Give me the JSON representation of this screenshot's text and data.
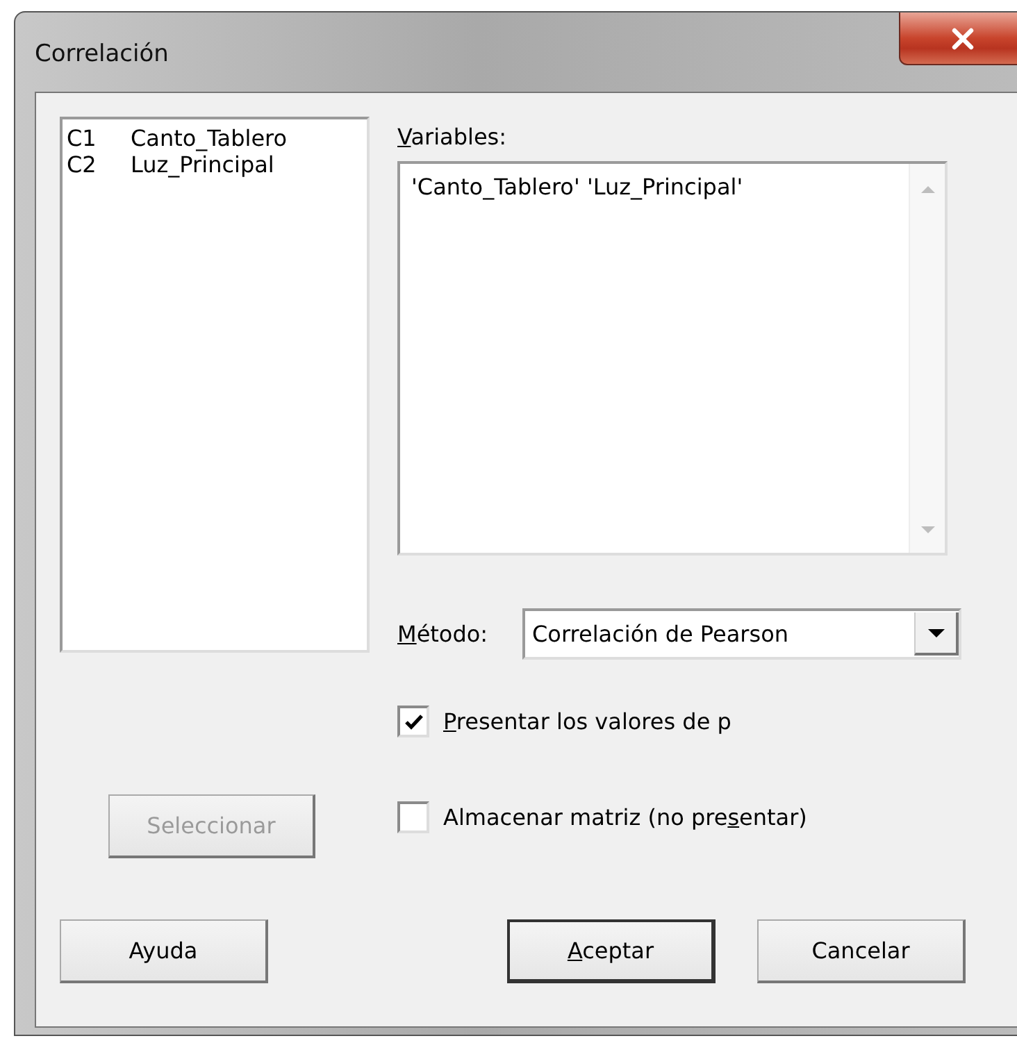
{
  "window": {
    "title": "Correlación"
  },
  "column_list": {
    "items": [
      {
        "id_label": "C1",
        "name": "Canto_Tablero"
      },
      {
        "id_label": "C2",
        "name": "Luz_Principal"
      }
    ]
  },
  "select_button": {
    "label": "Seleccionar",
    "disabled": true
  },
  "variables": {
    "label": [
      {
        "text": "V",
        "underlined": true
      },
      {
        "text": "ariables:",
        "underlined": false
      }
    ],
    "value": "'Canto_Tablero' 'Luz_Principal'"
  },
  "method": {
    "label": [
      {
        "text": "M",
        "underlined": true
      },
      {
        "text": "étodo:",
        "underlined": false
      }
    ],
    "value": "Correlación de Pearson"
  },
  "options": [
    {
      "label": [
        {
          "text": "P",
          "underlined": true
        },
        {
          "text": "resentar los valores de p",
          "underlined": false
        }
      ],
      "checked": true
    },
    {
      "label": [
        {
          "text": "Almacenar matriz (no pre",
          "underlined": false
        },
        {
          "text": "s",
          "underlined": true
        },
        {
          "text": "entar)",
          "underlined": false
        }
      ],
      "checked": false
    }
  ],
  "buttons": [
    {
      "label": [
        {
          "text": "Ayuda",
          "underlined": false
        }
      ],
      "default": false
    },
    {
      "label": [
        {
          "text": "A",
          "underlined": true
        },
        {
          "text": "ceptar",
          "underlined": false
        }
      ],
      "default": true
    },
    {
      "label": [
        {
          "text": "Cancelar",
          "underlined": false
        }
      ],
      "default": false
    }
  ]
}
